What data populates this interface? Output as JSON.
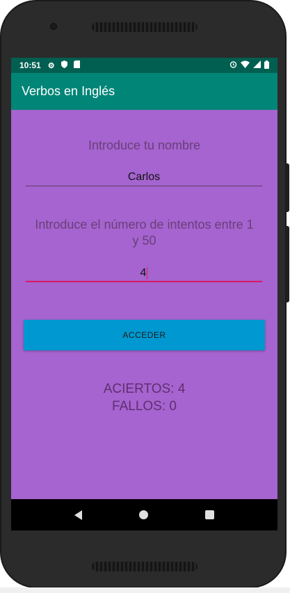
{
  "status_bar": {
    "time": "10:51",
    "left_icons": [
      "gear-icon",
      "shield-icon",
      "sd-card-icon"
    ],
    "right_icons": [
      "alarm-icon",
      "wifi-icon",
      "signal-icon",
      "battery-icon"
    ]
  },
  "app_bar": {
    "title": "Verbos en Inglés"
  },
  "form": {
    "name_label": "Introduce tu nombre",
    "name_value": "Carlos",
    "attempts_label_line1": "Introduce el número de intentos entre 1",
    "attempts_label_line2": "y 50",
    "attempts_value": "4",
    "access_button": "ACCEDER"
  },
  "results": {
    "hits": "ACIERTOS: 4",
    "misses": "FALLOS: 0"
  },
  "colors": {
    "background": "#a564cf",
    "app_bar": "#018577",
    "status_bar": "#015f51",
    "button": "#0098d0",
    "accent": "#d81b60"
  }
}
